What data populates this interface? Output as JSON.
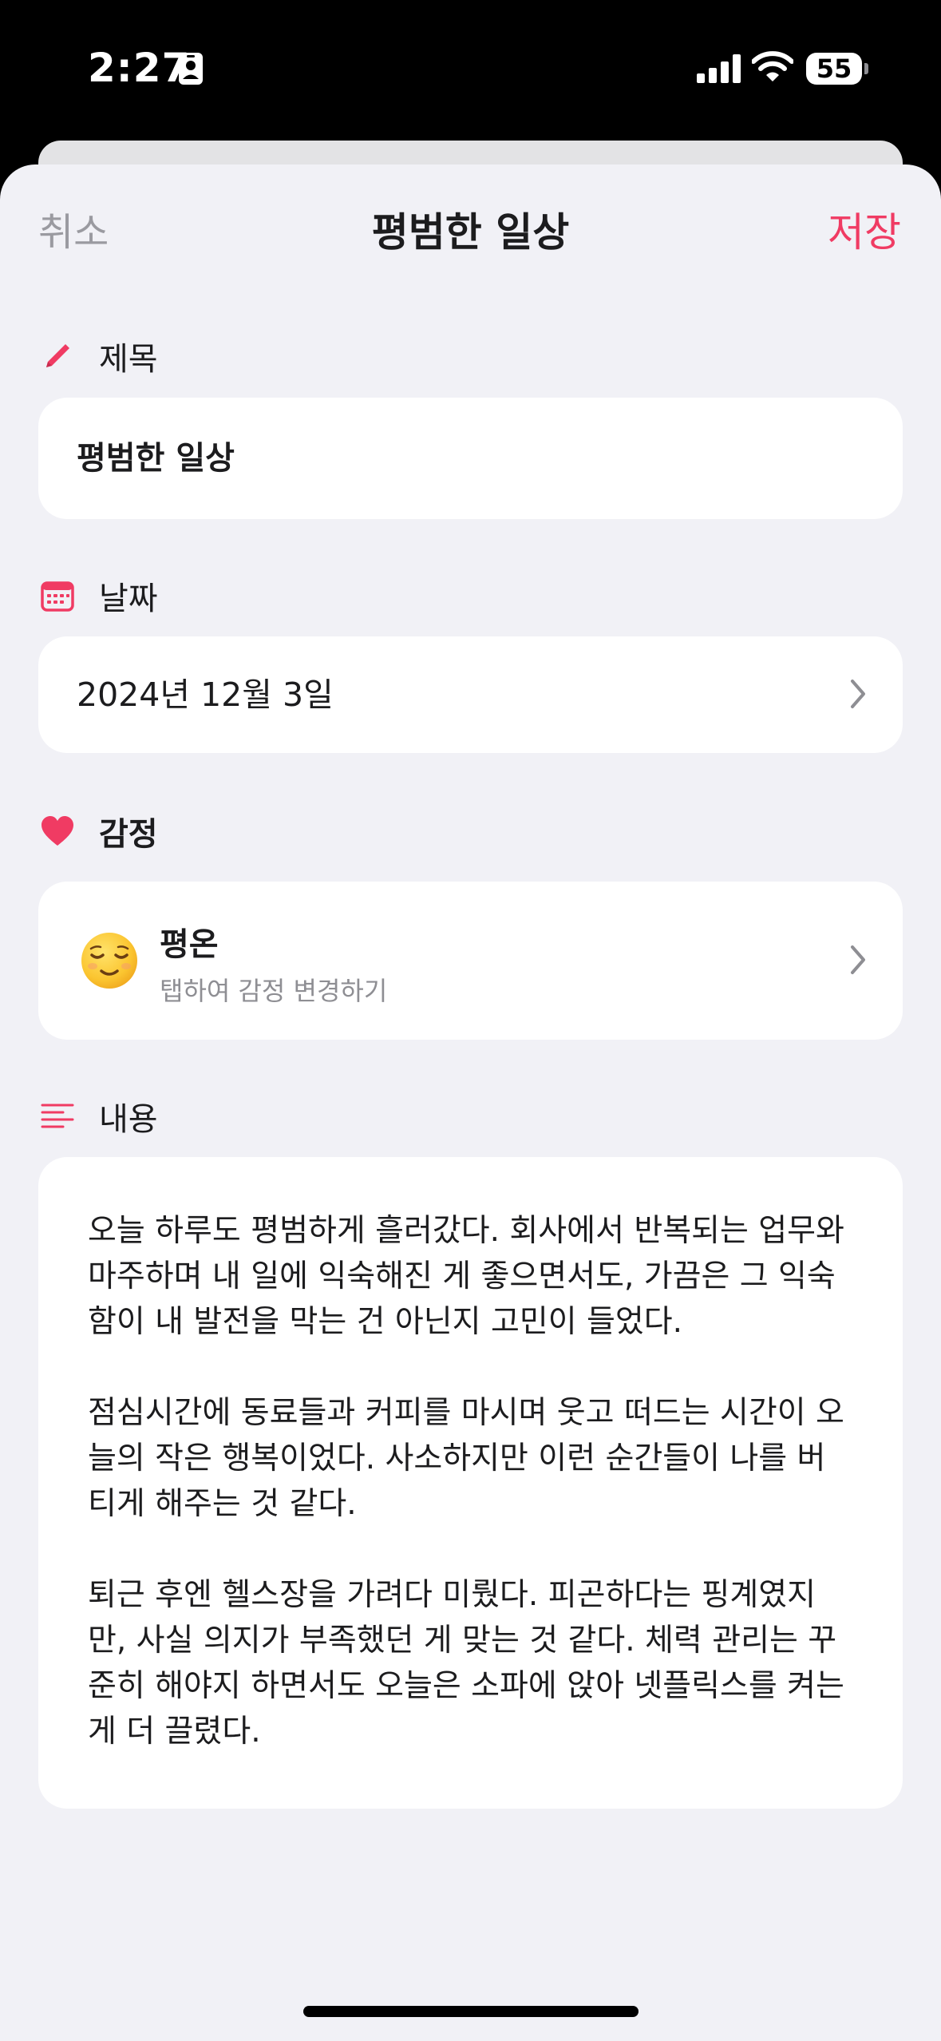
{
  "status_bar": {
    "time": "2:27",
    "battery": "55"
  },
  "nav": {
    "cancel_label": "취소",
    "title": "평범한 일상",
    "save_label": "저장"
  },
  "fields": {
    "title": {
      "label": "제목",
      "icon": "pencil-icon",
      "value": "평범한 일상"
    },
    "date": {
      "label": "날짜",
      "icon": "calendar-icon",
      "value": "2024년 12월 3일"
    },
    "emotion": {
      "label": "감정",
      "icon": "heart-icon",
      "emoji": "relieved-face-emoji",
      "name": "평온",
      "hint": "탭하여 감정 변경하기"
    },
    "content": {
      "label": "내용",
      "icon": "text-lines-icon",
      "paragraphs": [
        "오늘 하루도 평범하게 흘러갔다. 회사에서 반복되는 업무와\n마주하며 내 일에 익숙해진 게 좋으면서도, 가끔은 그 익숙\n함이 내 발전을 막는 건 아닌지 고민이 들었다.",
        "점심시간에 동료들과 커피를 마시며 웃고 떠드는 시간이 오\n늘의 작은 행복이었다. 사소하지만 이런 순간들이 나를 버\n티게 해주는 것 같다.",
        "퇴근 후엔 헬스장을 가려다 미뤘다. 피곤하다는 핑계였지\n만, 사실 의지가 부족했던 게 맞는 것 같다. 체력 관리는 꾸\n준히 해야지 하면서도 오늘은 소파에 앉아 넷플릭스를 켜는\n게 더 끌렸다."
      ]
    }
  },
  "colors": {
    "accent": "#f03b63",
    "sheet_background": "#f1f1f6",
    "card_background": "#ffffff",
    "secondary_text": "#8e8e93"
  }
}
